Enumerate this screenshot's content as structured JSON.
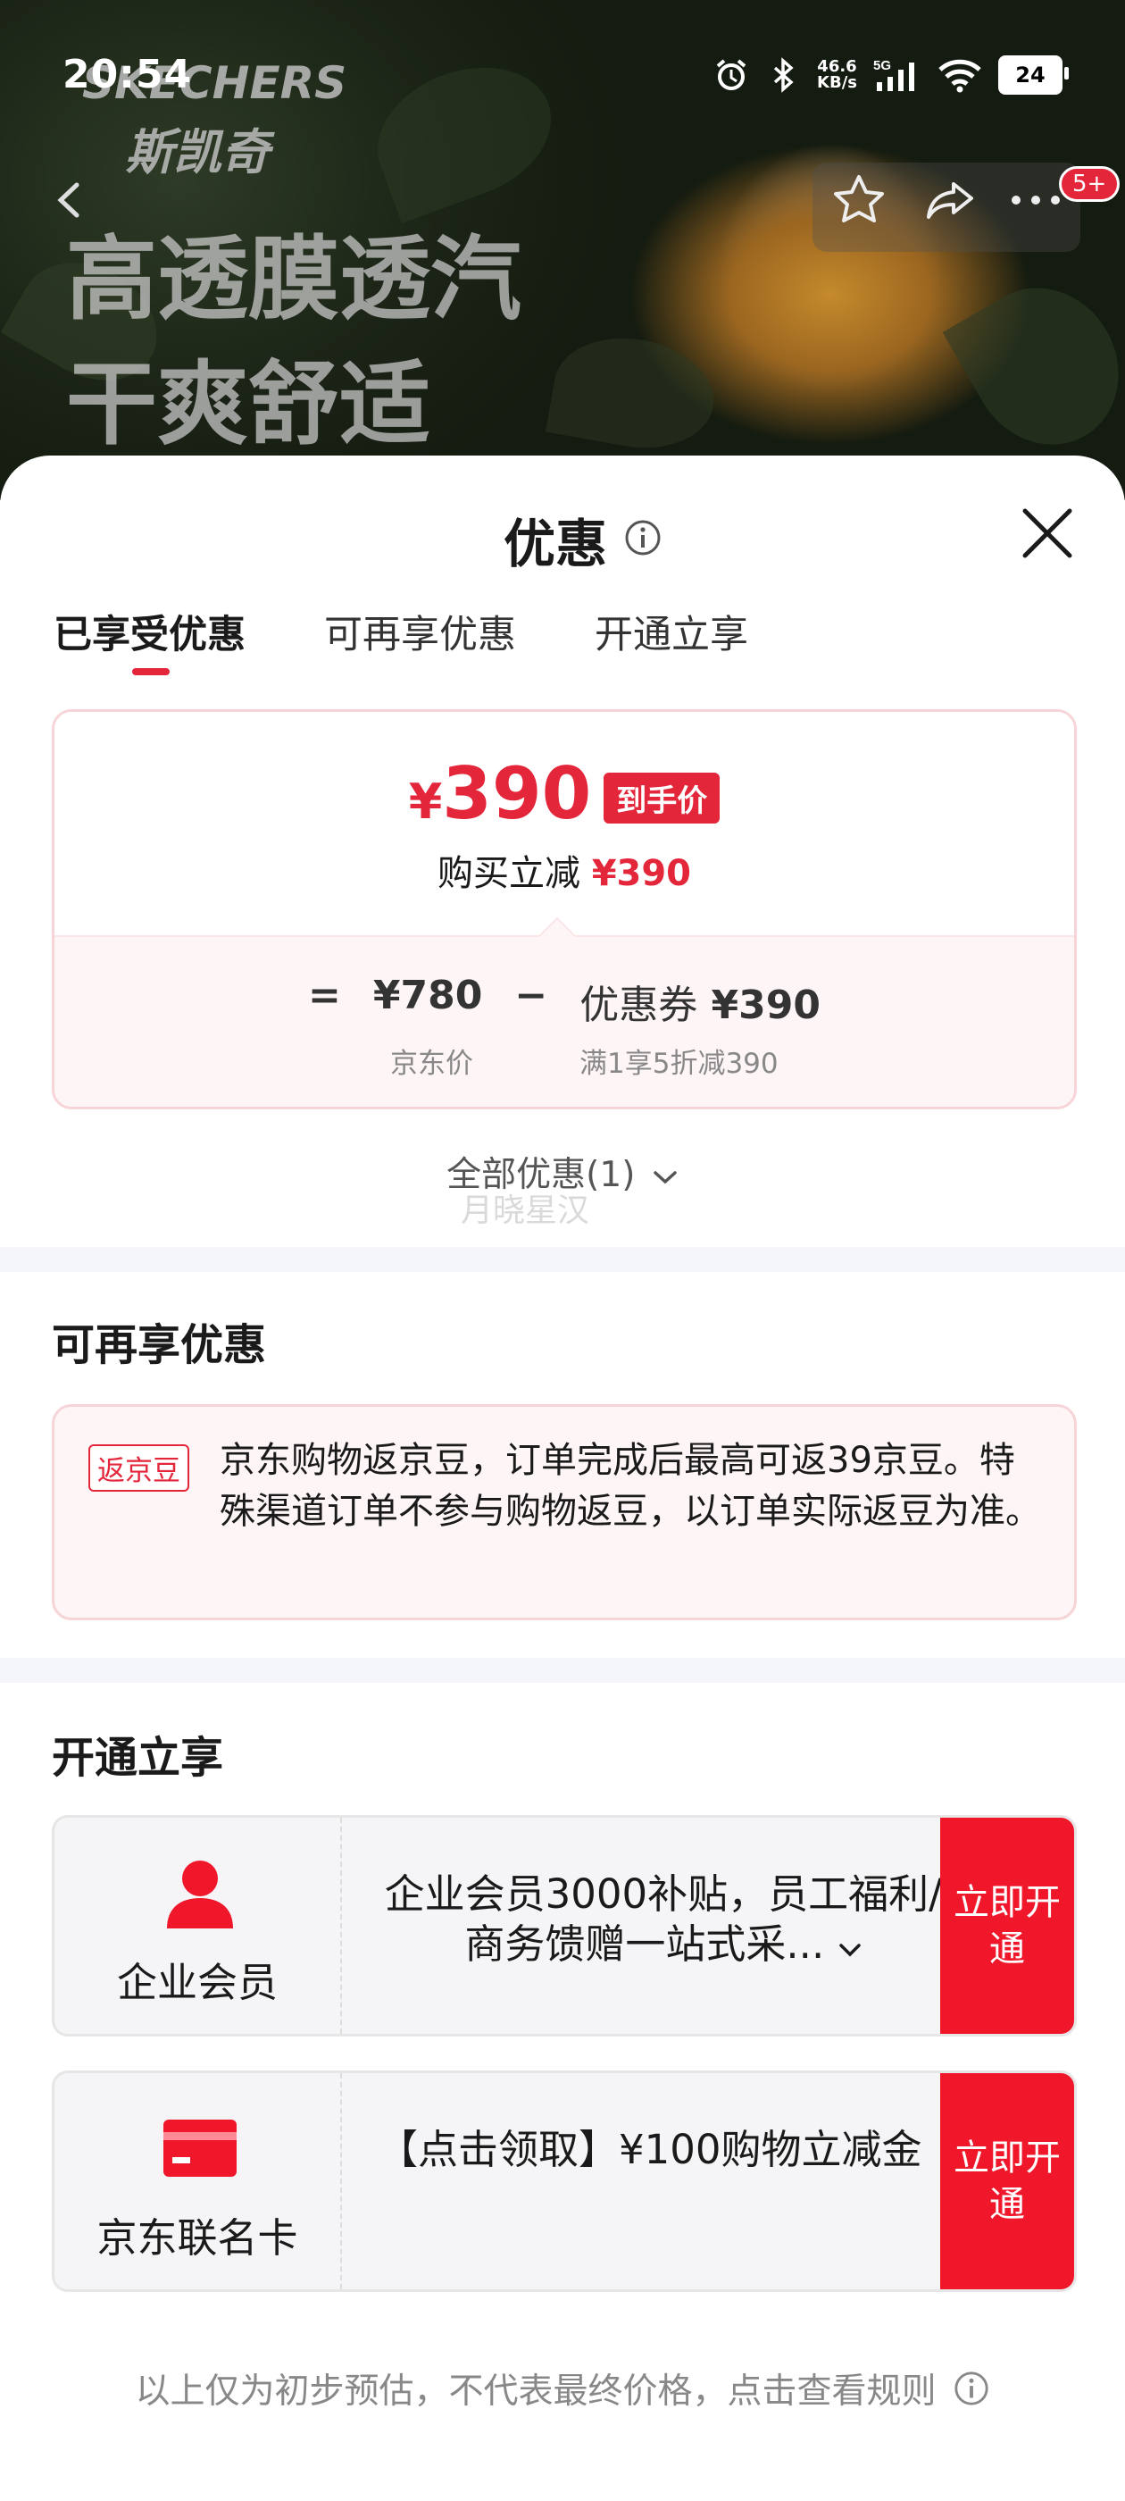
{
  "status_bar": {
    "time": "20:54",
    "net_speed_value": "46.6",
    "net_speed_unit": "KB/s",
    "signal": "5G",
    "battery": "24"
  },
  "hero": {
    "brand_en": "SKECHERS",
    "brand_cn": "斯凯奇",
    "slogan_line1": "高透膜透汽",
    "slogan_line2": "干爽舒适",
    "cart_badge": "5+"
  },
  "sheet": {
    "title": "优惠",
    "tabs": [
      {
        "label": "已享受优惠",
        "active": true
      },
      {
        "label": "可再享优惠",
        "active": false
      },
      {
        "label": "开通立享",
        "active": false
      }
    ],
    "price_card": {
      "currency": "¥",
      "final_price": "390",
      "price_tag": "到手价",
      "cut_label": "购买立减",
      "cut_value": "¥390",
      "eq": "=",
      "jd_price": "¥780",
      "jd_price_label": "京东价",
      "minus": "−",
      "coupon_label": "优惠券",
      "coupon_value": "¥390",
      "coupon_desc": "满1享5折减390"
    },
    "all_promo": "全部优惠(1)",
    "watermark": "月晓星汉",
    "reuse_section": {
      "title": "可再享优惠",
      "tag": "返京豆",
      "text": "京东购物返京豆，订单完成后最高可返39京豆。特殊渠道订单不参与购物返豆，以订单实际返豆为准。"
    },
    "open_section": {
      "title": "开通立享",
      "offers": [
        {
          "name": "企业会员",
          "desc": "企业会员3000补贴，员工福利/商务馈赠一站式采...",
          "button": "立即开通",
          "icon": "user-icon"
        },
        {
          "name": "京东联名卡",
          "desc": "【点击领取】¥100购物立减金",
          "button": "立即开通",
          "icon": "credit-card-icon"
        }
      ]
    },
    "footer_note": "以上仅为初步预估，不代表最终价格，点击查看规则"
  },
  "colors": {
    "accent": "#e4263b",
    "button": "#f0172b"
  }
}
